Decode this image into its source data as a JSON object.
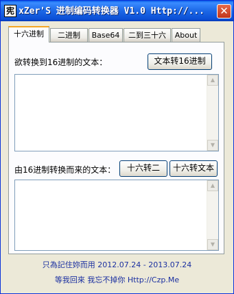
{
  "window": {
    "title": "xZer'S 进制编码转换器 V1.0 Http://...",
    "icon_char": "宪",
    "close_symbol": "✕"
  },
  "tabs": [
    "十六进制",
    "二进制",
    "Base64",
    "二到三十六",
    "About"
  ],
  "hex_panel": {
    "input_label": "欲转换到16进制的文本：",
    "to_hex_button": "文本转16进制",
    "output_label": "由16进制转换而来的文本：",
    "hex_to_binary_button": "十六转二",
    "hex_to_text_button": "十六转文本",
    "input_text": "",
    "output_text": ""
  },
  "footer": {
    "line1": "只為記住妳而用 2012.07.24 - 2013.07.24",
    "line2": "等我回來 我忘不掉你 Http://Czp.Me"
  },
  "colors": {
    "titlebar": "#0b4fd6",
    "active_tab_accent": "#f5a623",
    "footer_text": "#1a2fa0"
  }
}
